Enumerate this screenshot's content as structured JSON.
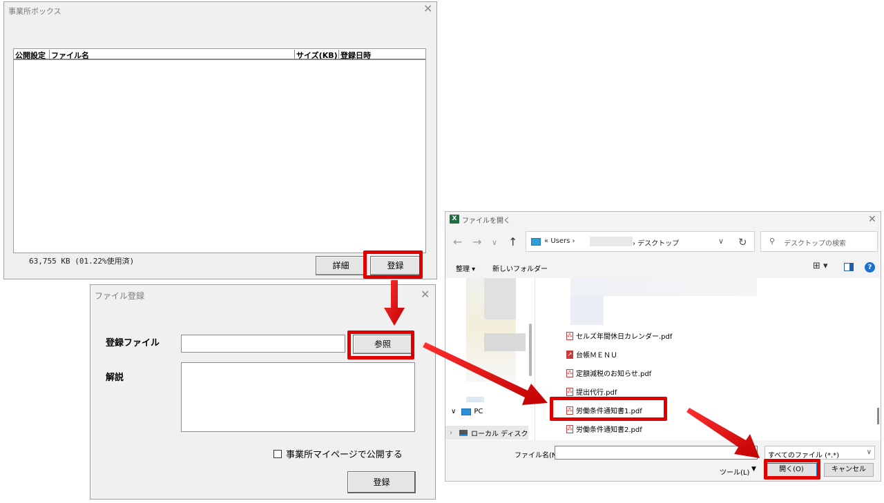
{
  "office_box": {
    "title": "事業所ボックス",
    "close": "✕",
    "columns": [
      "公開設定",
      "ファイル名",
      "サイズ(KB)",
      "登録日時"
    ],
    "usage": "63,755 KB (01.22%使用済)",
    "detail_label": "詳細",
    "register_label": "登録"
  },
  "file_register": {
    "title": "ファイル登録",
    "close": "✕",
    "file_label": "登録ファイル",
    "browse_label": "参照",
    "desc_label": "解説",
    "publish_label": "事業所マイページで公開する",
    "register_label": "登録"
  },
  "open_dialog": {
    "title": "ファイルを開く",
    "app_icon": "X",
    "close": "✕",
    "address": {
      "prefix": "«",
      "users": "Users ›",
      "desktop": "› デスクトップ"
    },
    "search_placeholder": "デスクトップの検索",
    "organize": "整理 ▾",
    "new_folder": "新しいフォルダー",
    "nav": {
      "pc": "PC",
      "local_disk": "ローカル ディスク"
    },
    "files": [
      {
        "name": "セルズ年間休日カレンダー.pdf",
        "icon": "pdf-icon"
      },
      {
        "name": "台帳ＭＥＮＵ",
        "icon": "shortcut-icon"
      },
      {
        "name": "定額減税のお知らせ.pdf",
        "icon": "pdf-icon"
      },
      {
        "name": "提出代行.pdf",
        "icon": "pdf-icon"
      },
      {
        "name": "労働条件通知書1.pdf",
        "icon": "pdf-icon"
      },
      {
        "name": "労働条件通知書2.pdf",
        "icon": "pdf-icon"
      }
    ],
    "filename_label": "ファイル名(N):",
    "filter": "すべてのファイル (*.*)",
    "tools": "ツール(L)",
    "open_label": "開く(O)",
    "cancel_label": "キャンセル"
  },
  "colors": {
    "highlight": "#e00000",
    "arrow": "#e00000"
  }
}
